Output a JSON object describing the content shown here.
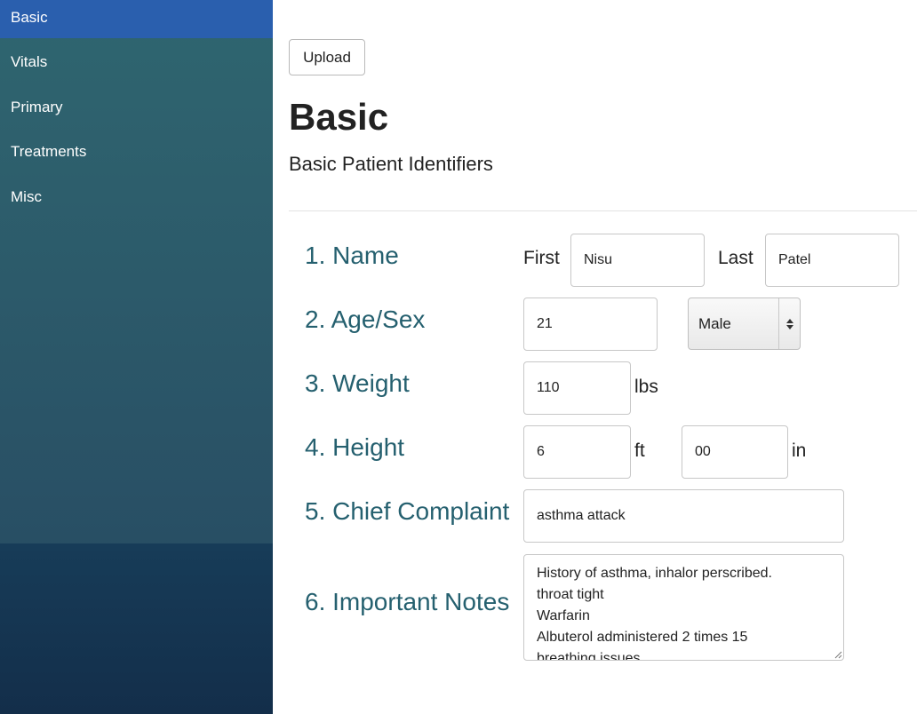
{
  "sidebar": {
    "items": [
      {
        "label": "Basic",
        "active": true
      },
      {
        "label": "Vitals"
      },
      {
        "label": "Primary"
      },
      {
        "label": "Treatments"
      },
      {
        "label": "Misc"
      }
    ],
    "active_color": "#2a5fae"
  },
  "toolbar": {
    "upload_label": "Upload"
  },
  "header": {
    "title": "Basic",
    "subtitle": "Basic Patient Identifiers"
  },
  "form": {
    "name": {
      "label": "1. Name",
      "first_label": "First",
      "first_value": "Nisu",
      "last_label": "Last",
      "last_value": "Patel"
    },
    "age_sex": {
      "label": "2. Age/Sex",
      "age_value": "21",
      "sex_selected": "Male"
    },
    "weight": {
      "label": "3. Weight",
      "value": "110",
      "unit": "lbs"
    },
    "height": {
      "label": "4. Height",
      "feet_value": "6",
      "feet_unit": "ft",
      "inches_value": "00",
      "inches_unit": "in"
    },
    "chief_complaint": {
      "label": "5. Chief Complaint",
      "value": "asthma attack"
    },
    "notes": {
      "label": "6. Important Notes",
      "lines": [
        "History of asthma, inhalor perscribed.",
        "throat tight",
        "Warfarin",
        "Albuterol administered 2 times 15",
        "breathing issues"
      ]
    },
    "label_color": "#25606f"
  }
}
